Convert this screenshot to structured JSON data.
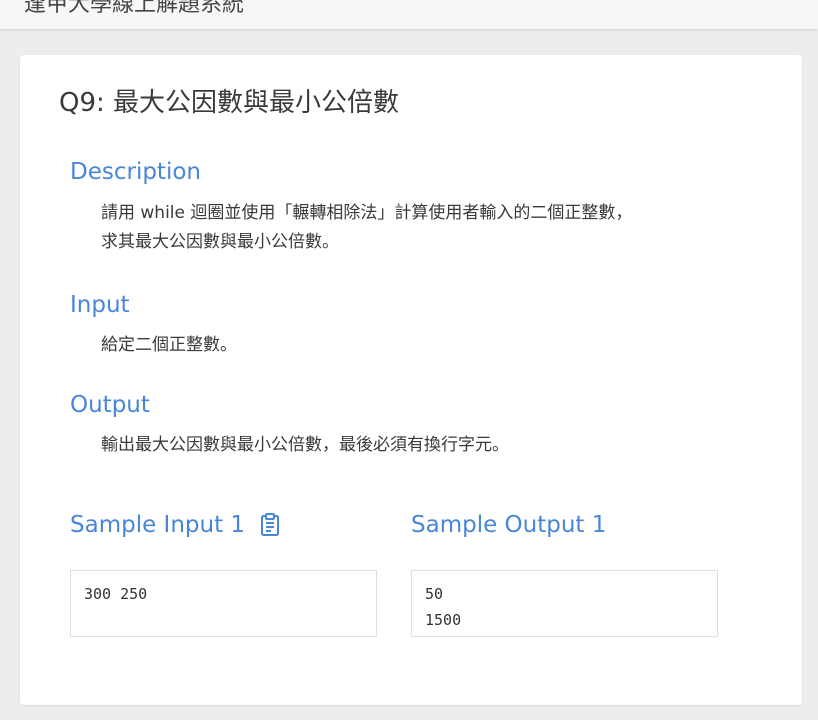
{
  "header": {
    "title": "逢甲大學線上解題系統"
  },
  "problem": {
    "title": "Q9: 最大公因數與最小公倍數"
  },
  "description": {
    "heading": "Description",
    "lines": [
      "請用 while 迴圈並使用「輾轉相除法」計算使用者輸入的二個正整數，",
      "求其最大公因數與最小公倍數。"
    ]
  },
  "input": {
    "heading": "Input",
    "lines": [
      "給定二個正整數。"
    ]
  },
  "output": {
    "heading": "Output",
    "lines": [
      "輸出最大公因數與最小公倍數，最後必須有換行字元。"
    ]
  },
  "samples": {
    "input_heading": "Sample Input 1",
    "output_heading": "Sample Output 1",
    "input_lines": [
      "300 250"
    ],
    "output_lines": [
      "50",
      "1500"
    ],
    "copy_icon": "clipboard-icon"
  },
  "colors": {
    "accent": "#4a86d8",
    "text": "#3a3a3a",
    "background": "#ededed"
  }
}
